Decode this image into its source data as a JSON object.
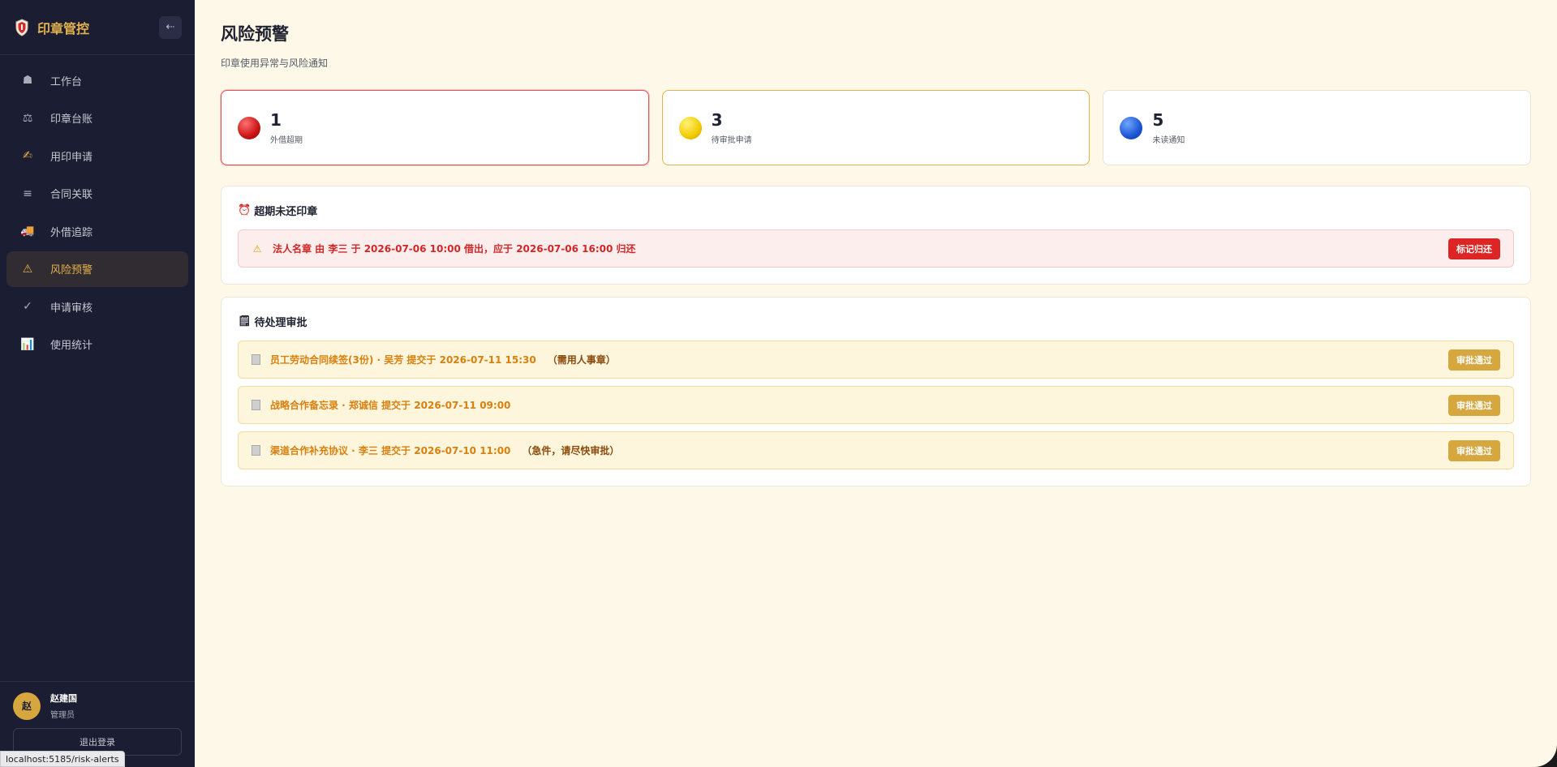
{
  "brand": {
    "title": "印章管控",
    "collapse_icon": "arrow-left-icon"
  },
  "sidebar": {
    "items": [
      {
        "label": "工作台",
        "icon": "bell-icon",
        "glyph": "☗",
        "active": false
      },
      {
        "label": "印章台账",
        "icon": "scales-icon",
        "glyph": "⚖",
        "active": false
      },
      {
        "label": "用印申请",
        "icon": "writing-hand-icon",
        "glyph": "✍",
        "active": false
      },
      {
        "label": "合同关联",
        "icon": "menu-icon",
        "glyph": "≡",
        "active": false
      },
      {
        "label": "外借追踪",
        "icon": "truck-icon",
        "glyph": "🚚",
        "active": false
      },
      {
        "label": "风险预警",
        "icon": "warning-icon",
        "glyph": "⚠",
        "active": true
      },
      {
        "label": "申请审核",
        "icon": "check-icon",
        "glyph": "✓",
        "active": false
      },
      {
        "label": "使用统计",
        "icon": "bar-chart-icon",
        "glyph": "📊",
        "active": false
      }
    ]
  },
  "user": {
    "avatar": "赵",
    "name": "赵建国",
    "role": "管理员",
    "logout_label": "退出登录"
  },
  "status_url": "localhost:5185/risk-alerts",
  "page": {
    "title": "风险预警",
    "subtitle": "印章使用异常与风险通知"
  },
  "stats": [
    {
      "value": "1",
      "label": "外借超期",
      "color": "#dc2626"
    },
    {
      "value": "3",
      "label": "待审批申请",
      "color": "#f2cc00"
    },
    {
      "value": "5",
      "label": "未读通知",
      "color": "#1c56d4"
    }
  ],
  "overdue": {
    "title": "超期未还印章",
    "icon": "alarm-clock-icon",
    "items": [
      {
        "text": "法人名章 由 李三 于 2026-07-06 10:00 借出，应于 2026-07-06 16:00 归还",
        "action": "标记归还"
      }
    ]
  },
  "pending": {
    "title": "待处理审批",
    "icon": "notepad-icon",
    "items": [
      {
        "text": "员工劳动合同续签(3份) · 吴芳 提交于 2026-07-11 15:30",
        "note": "（需用人事章）",
        "action": "审批通过"
      },
      {
        "text": "战略合作备忘录 · 郑诚信 提交于 2026-07-11 09:00",
        "note": "",
        "action": "审批通过"
      },
      {
        "text": "渠道合作补充协议 · 李三 提交于 2026-07-10 11:00",
        "note": "（急件，请尽快审批）",
        "action": "审批通过"
      }
    ]
  }
}
